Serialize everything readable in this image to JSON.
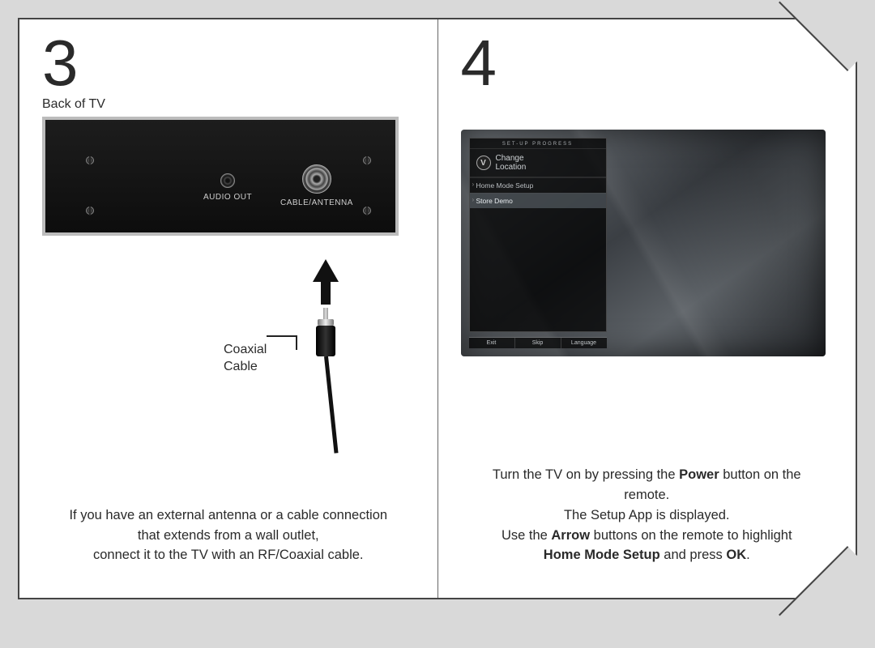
{
  "step3": {
    "number": "3",
    "sublabel": "Back of TV",
    "ports": {
      "audio_out": "AUDIO OUT",
      "cable_antenna": "CABLE/ANTENNA"
    },
    "coax_label_line1": "Coaxial",
    "coax_label_line2": "Cable",
    "instruction_line1": "If you have an external antenna or a cable connection",
    "instruction_line2": "that extends from a wall outlet,",
    "instruction_line3": "connect it to the TV with an RF/Coaxial cable."
  },
  "step4": {
    "number": "4",
    "screen": {
      "setup_progress": "SET-UP  PROGRESS",
      "header_line1": "Change",
      "header_line2": "Location",
      "item1": "Home Mode Setup",
      "item2": "Store Demo",
      "footer": {
        "exit": "Exit",
        "skip": "Skip",
        "language": "Language"
      }
    },
    "instruction": {
      "l1a": "Turn the TV on by pressing the ",
      "l1b_bold": "Power",
      "l1c": " button on the",
      "l2": "remote.",
      "l3": "The Setup App is displayed.",
      "l4a": "Use the ",
      "l4b_bold": "Arrow",
      "l4c": " buttons on the remote to highlight",
      "l5a_bold": "Home Mode Setup",
      "l5b": " and press ",
      "l5c_bold": "OK",
      "l5d": "."
    }
  }
}
